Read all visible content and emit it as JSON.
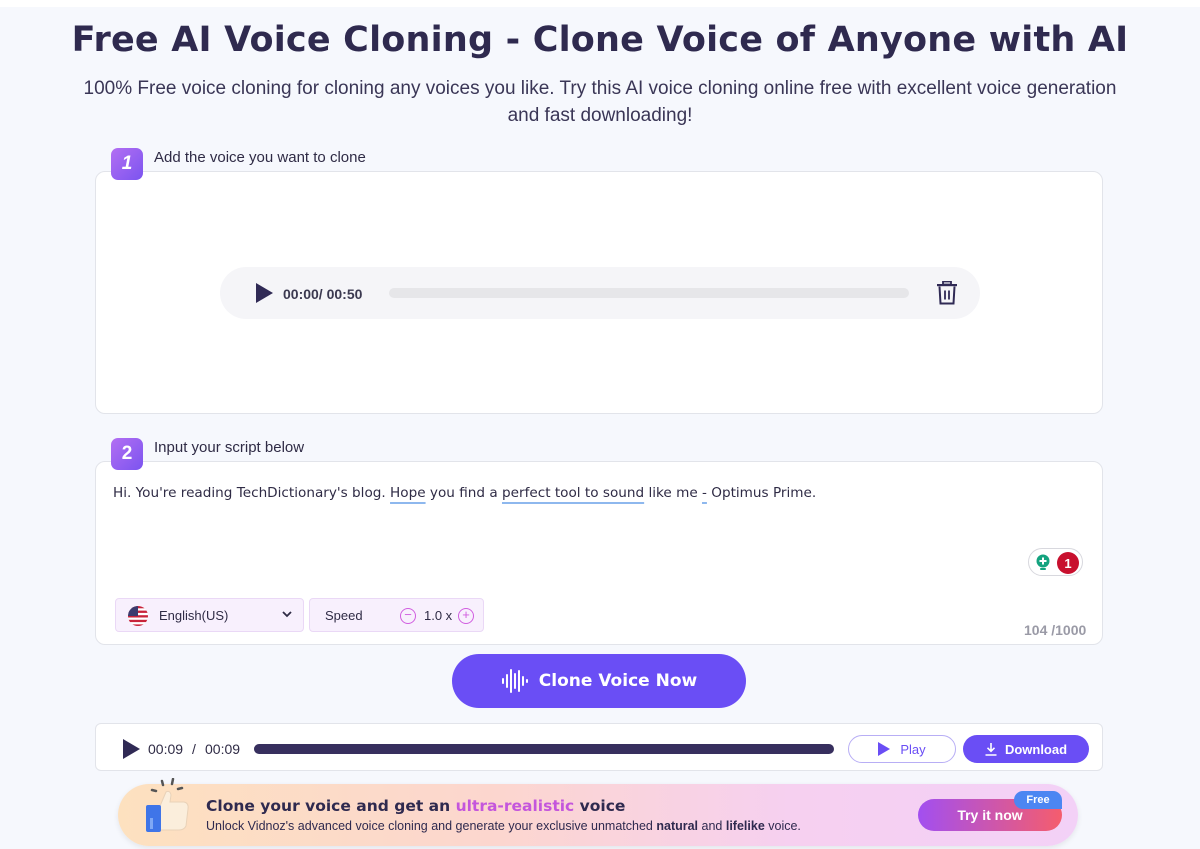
{
  "header": {
    "title": "Free AI Voice Cloning - Clone Voice of Anyone with AI",
    "subtitle_line1": "100% Free voice cloning for cloning any voices you like. Try this AI voice cloning online free with excellent voice generation",
    "subtitle_line2": "and fast downloading!"
  },
  "step1": {
    "number": "1",
    "label": "Add the voice you want to clone",
    "player": {
      "time": "00:00/ 00:50",
      "progress_percent": 0,
      "play_icon": "play-icon",
      "delete_icon": "trash-icon"
    }
  },
  "step2": {
    "number": "2",
    "label": "Input your script below",
    "script": {
      "part1": "Hi. You're reading TechDictionary's blog. ",
      "u1": "Hope",
      "part2": " you find a ",
      "u2": "perfect tool to sound",
      "part3": " like me ",
      "u3": "-",
      "part4": " Optimus Prime."
    },
    "grammar_errors": "1",
    "language": "English(US)",
    "speed_label": "Speed",
    "speed_value": "1.0 x",
    "char_count": "104 /1000"
  },
  "clone_button": "Clone Voice Now",
  "result_player": {
    "current_time": "00:09",
    "separator": "/",
    "total_time": "00:09",
    "progress_percent": 100,
    "play_label": "Play",
    "download_label": "Download"
  },
  "promo": {
    "title_pre": "Clone your voice and get an ",
    "title_highlight": "ultra-realistic",
    "title_post": " voice",
    "sub_pre": "Unlock Vidnoz's advanced voice cloning and generate your exclusive unmatched ",
    "sub_bold1": "natural",
    "sub_mid": " and ",
    "sub_bold2": "lifelike",
    "sub_post": " voice.",
    "cta": "Try it now",
    "tag": "Free"
  },
  "colors": {
    "accent": "#6a4ef5",
    "dark": "#2f2a4f",
    "highlight": "#c456dc",
    "error": "#c8102e"
  }
}
